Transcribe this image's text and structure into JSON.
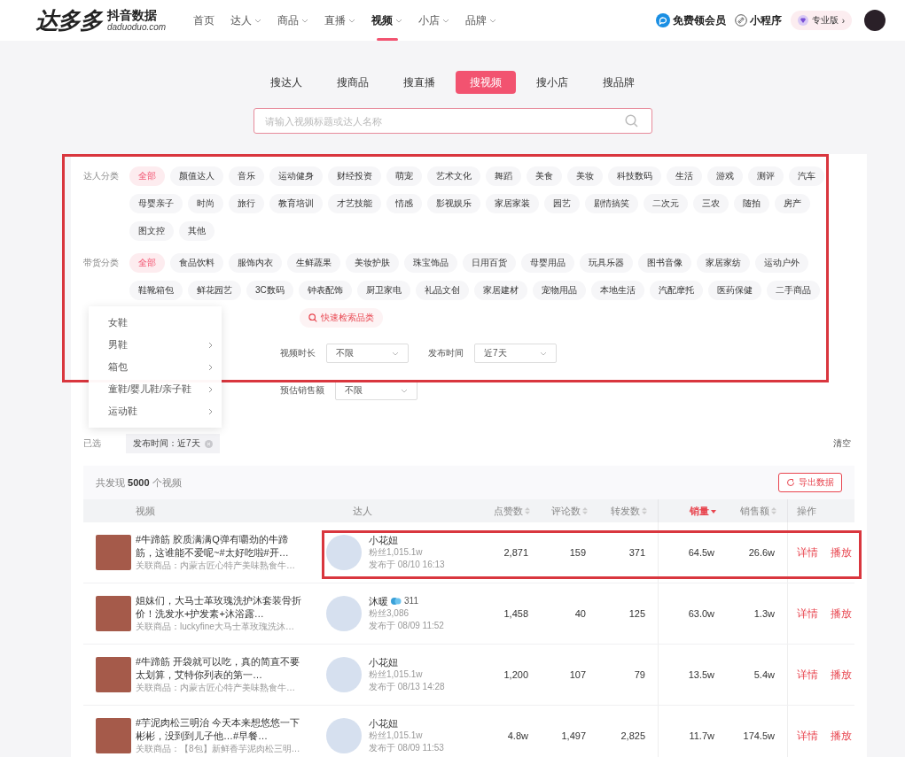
{
  "header": {
    "logo": "达多多",
    "logo_sub": "抖音数据",
    "logo_domain": "daduoduo.com",
    "nav": [
      {
        "label": "首页",
        "dropdown": false,
        "selected": false
      },
      {
        "label": "达人",
        "dropdown": true,
        "selected": false
      },
      {
        "label": "商品",
        "dropdown": true,
        "selected": false
      },
      {
        "label": "直播",
        "dropdown": true,
        "selected": false
      },
      {
        "label": "视频",
        "dropdown": true,
        "selected": true
      },
      {
        "label": "小店",
        "dropdown": true,
        "selected": false
      },
      {
        "label": "品牌",
        "dropdown": true,
        "selected": false
      }
    ],
    "vip": "免费领会员",
    "mini_program": "小程序",
    "plan": "专业版",
    "plan_arrow": "›"
  },
  "search": {
    "tabs": [
      {
        "label": "搜达人",
        "selected": false
      },
      {
        "label": "搜商品",
        "selected": false
      },
      {
        "label": "搜直播",
        "selected": false
      },
      {
        "label": "搜视频",
        "selected": true
      },
      {
        "label": "搜小店",
        "selected": false
      },
      {
        "label": "搜品牌",
        "selected": false
      }
    ],
    "placeholder": "请输入视频标题或达人名称"
  },
  "filters": {
    "highlighted": true,
    "groups": [
      {
        "label": "达人分类",
        "options": [
          {
            "label": "全部",
            "selected": true
          },
          {
            "label": "颜值达人",
            "selected": false
          },
          {
            "label": "音乐",
            "selected": false
          },
          {
            "label": "运动健身",
            "selected": false
          },
          {
            "label": "财经投资",
            "selected": false
          },
          {
            "label": "萌宠",
            "selected": false
          },
          {
            "label": "艺术文化",
            "selected": false
          },
          {
            "label": "舞蹈",
            "selected": false
          },
          {
            "label": "美食",
            "selected": false
          },
          {
            "label": "美妆",
            "selected": false
          },
          {
            "label": "科技数码",
            "selected": false
          },
          {
            "label": "生活",
            "selected": false
          },
          {
            "label": "游戏",
            "selected": false
          },
          {
            "label": "测评",
            "selected": false
          },
          {
            "label": "汽车",
            "selected": false
          },
          {
            "label": "母婴亲子",
            "selected": false
          },
          {
            "label": "时尚",
            "selected": false
          },
          {
            "label": "旅行",
            "selected": false
          },
          {
            "label": "教育培训",
            "selected": false
          },
          {
            "label": "才艺技能",
            "selected": false
          },
          {
            "label": "情感",
            "selected": false
          },
          {
            "label": "影视娱乐",
            "selected": false
          },
          {
            "label": "家居家装",
            "selected": false
          },
          {
            "label": "园艺",
            "selected": false
          },
          {
            "label": "剧情搞笑",
            "selected": false
          },
          {
            "label": "二次元",
            "selected": false
          },
          {
            "label": "三农",
            "selected": false
          },
          {
            "label": "随拍",
            "selected": false
          },
          {
            "label": "房产",
            "selected": false
          },
          {
            "label": "图文控",
            "selected": false
          },
          {
            "label": "其他",
            "selected": false
          }
        ]
      },
      {
        "label": "带货分类",
        "quick_search": "快速检索品类",
        "options": [
          {
            "label": "全部",
            "selected": true
          },
          {
            "label": "食品饮料",
            "selected": false
          },
          {
            "label": "服饰内衣",
            "selected": false
          },
          {
            "label": "生鲜蔬果",
            "selected": false
          },
          {
            "label": "美妆护肤",
            "selected": false
          },
          {
            "label": "珠宝饰品",
            "selected": false
          },
          {
            "label": "日用百货",
            "selected": false
          },
          {
            "label": "母婴用品",
            "selected": false
          },
          {
            "label": "玩具乐器",
            "selected": false
          },
          {
            "label": "图书音像",
            "selected": false
          },
          {
            "label": "家居家纺",
            "selected": false
          },
          {
            "label": "运动户外",
            "selected": false
          },
          {
            "label": "鞋靴箱包",
            "selected": false
          },
          {
            "label": "鲜花园艺",
            "selected": false
          },
          {
            "label": "3C数码",
            "selected": false
          },
          {
            "label": "钟表配饰",
            "selected": false
          },
          {
            "label": "厨卫家电",
            "selected": false
          },
          {
            "label": "礼品文创",
            "selected": false
          },
          {
            "label": "家居建材",
            "selected": false
          },
          {
            "label": "宠物用品",
            "selected": false
          },
          {
            "label": "本地生活",
            "selected": false
          },
          {
            "label": "汽配摩托",
            "selected": false
          },
          {
            "label": "医药保健",
            "selected": false
          },
          {
            "label": "二手商品",
            "selected": false
          }
        ]
      }
    ],
    "select_rows": [
      [
        {
          "label": "视频时长",
          "value": "不限"
        },
        {
          "label": "发布时间",
          "value": "近7天"
        }
      ],
      [
        {
          "label": "预估销售额",
          "value": "不限"
        }
      ]
    ],
    "chosen_label": "已选",
    "chips": [
      {
        "text": "发布时间：近7天"
      }
    ],
    "clear": "清空"
  },
  "menu": {
    "items": [
      {
        "label": "女鞋",
        "submenu": false
      },
      {
        "label": "男鞋",
        "submenu": true
      },
      {
        "label": "箱包",
        "submenu": true
      },
      {
        "label": "童鞋/婴儿鞋/亲子鞋",
        "submenu": true
      },
      {
        "label": "运动鞋",
        "submenu": true
      }
    ]
  },
  "results": {
    "summary": "共发现 **5000** 个视频",
    "export": "导出数据",
    "columns": [
      {
        "label": "视频",
        "sortable": false,
        "sorted": false
      },
      {
        "label": "达人",
        "sortable": false,
        "sorted": false
      },
      {
        "label": "点赞数",
        "sortable": true,
        "sorted": false
      },
      {
        "label": "评论数",
        "sortable": true,
        "sorted": false
      },
      {
        "label": "转发数",
        "sortable": true,
        "sorted": false
      },
      {
        "label": "销量",
        "sortable": true,
        "sorted": true
      },
      {
        "label": "销售额",
        "sortable": true,
        "sorted": false
      },
      {
        "label": "操作",
        "sortable": false,
        "sorted": false
      }
    ],
    "rows": [
      {
        "highlighted": true,
        "title": "#牛蹄筋 胶质满满Q弹有嚼劲的牛蹄筋，这谁能不爱呢~#太好吃啦#开…",
        "product": "关联商品：内蒙古匠心特产美味熟食牛…",
        "talent": "小花妞",
        "fans": "粉丝1,015.1w",
        "published": "发布于 08/10 16:13",
        "likes": "2,871",
        "comments": "159",
        "shares": "371",
        "sales": "64.5w",
        "revenue": "26.6w",
        "actions": [
          "详情",
          "播放"
        ]
      },
      {
        "highlighted": false,
        "title": "姐妹们，大马士革玫瑰洗护沐套装骨折价！洗发水+护发素+沐浴露…",
        "product": "关联商品：luckyfine大马士革玫瑰洗沐…",
        "talent": "沐暖",
        "badge": "311",
        "fans": "粉丝3,086",
        "published": "发布于 08/09 11:52",
        "likes": "1,458",
        "comments": "40",
        "shares": "125",
        "sales": "63.0w",
        "revenue": "1.3w",
        "actions": [
          "详情",
          "播放"
        ]
      },
      {
        "highlighted": false,
        "title": "#牛蹄筋 开袋就可以吃，真的简直不要太划算，艾特你列表的第一…",
        "product": "关联商品：内蒙古匠心特产美味熟食牛…",
        "talent": "小花妞",
        "fans": "粉丝1,015.1w",
        "published": "发布于 08/13 14:28",
        "likes": "1,200",
        "comments": "107",
        "shares": "79",
        "sales": "13.5w",
        "revenue": "5.4w",
        "actions": [
          "详情",
          "播放"
        ]
      },
      {
        "highlighted": false,
        "title": "#芋泥肉松三明治 今天本来想悠悠一下彬彬，没到到儿子他…#早餐…",
        "product": "关联商品：【8包】新鲜香芋泥肉松三明…",
        "talent": "小花妞",
        "fans": "粉丝1,015.1w",
        "published": "发布于 08/09 11:53",
        "likes": "4.8w",
        "comments": "1,497",
        "shares": "2,825",
        "sales": "11.7w",
        "revenue": "174.5w",
        "actions": [
          "详情",
          "播放"
        ]
      }
    ]
  }
}
